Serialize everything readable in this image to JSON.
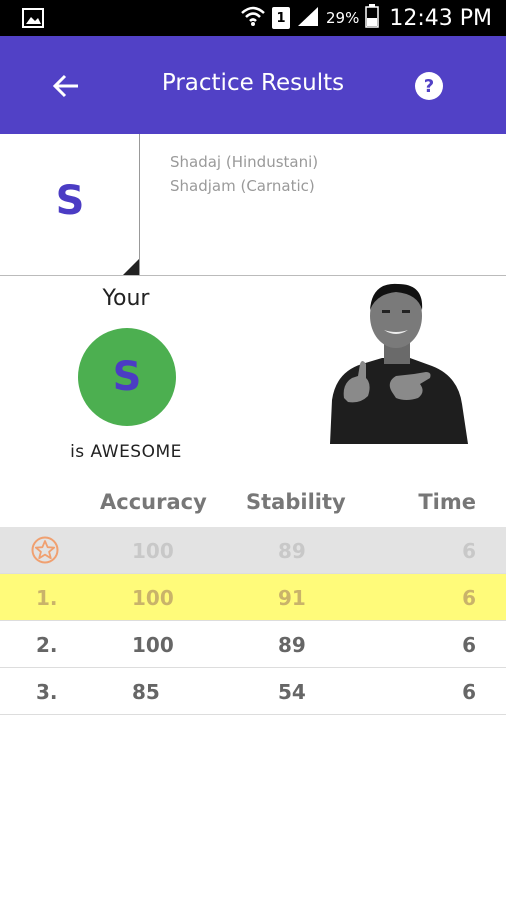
{
  "status_bar": {
    "sim_slot": "1",
    "battery_percent": "29%",
    "time": "12:43 PM"
  },
  "app_bar": {
    "title": "Practice Results",
    "help_symbol": "?"
  },
  "note": {
    "symbol": "S",
    "names": [
      "Shadaj (Hindustani)",
      "Shadjam (Carnatic)"
    ]
  },
  "result": {
    "prefix": "Your",
    "symbol": "S",
    "verdict": "is AWESOME"
  },
  "table": {
    "headers": [
      "Accuracy",
      "Stability",
      "Time"
    ],
    "best": {
      "accuracy": "100",
      "stability": "89",
      "time": "6"
    },
    "rows": [
      {
        "rank": "1.",
        "accuracy": "100",
        "stability": "91",
        "time": "6"
      },
      {
        "rank": "2.",
        "accuracy": "100",
        "stability": "89",
        "time": "6"
      },
      {
        "rank": "3.",
        "accuracy": "85",
        "stability": "54",
        "time": "6"
      }
    ]
  },
  "colors": {
    "app_bar": "#5141c6",
    "note_symbol": "#4b3cc4",
    "result_circle": "#4caf50",
    "highlight_row": "#fffb7a",
    "best_row": "#e3e3e3",
    "star_badge": "#f0a070"
  },
  "icons": {
    "gallery": "image-icon",
    "wifi": "wifi-icon",
    "signal": "signal-icon",
    "battery": "battery-icon",
    "back": "arrow-left-icon",
    "help": "help-circle-icon",
    "best": "star-badge-icon"
  }
}
